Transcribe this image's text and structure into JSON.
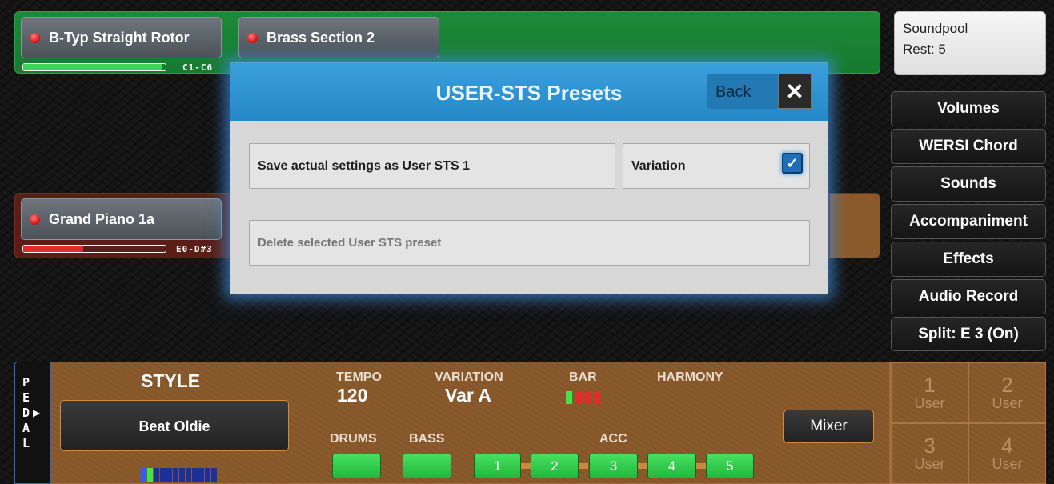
{
  "upper_manual": {
    "sounds": [
      {
        "name": "B-Typ Straight Rotor",
        "range": "C1-C6",
        "level": 0.98
      },
      {
        "name": "Brass Section 2"
      }
    ]
  },
  "lower_manual": {
    "sounds": [
      {
        "name": "Grand Piano 1a",
        "range": "E0-D#3",
        "level": 0.42
      }
    ]
  },
  "soundpool": {
    "line1": "Soundpool",
    "line2": "Rest: 5"
  },
  "side_menu": [
    "Volumes",
    "WERSI Chord",
    "Sounds",
    "Accompaniment",
    "Effects",
    "Audio Record",
    "Split: E 3 (On)"
  ],
  "dialog": {
    "title": "USER-STS Presets",
    "back": "Back",
    "close": "✕",
    "save_label": "Save actual settings as User STS 1",
    "variation_label": "Variation",
    "variation_checked": true,
    "delete_label": "Delete selected User STS preset"
  },
  "pedal": {
    "letters": [
      "P",
      "E",
      "D",
      "A",
      "L"
    ]
  },
  "style_panel": {
    "style_title": "STYLE",
    "style_name": "Beat Oldie",
    "tempo_label": "TEMPO",
    "tempo_value": "120",
    "variation_label": "VARIATION",
    "variation_value": "Var A",
    "bar_label": "BAR",
    "bar_current": 1,
    "bar_count": 4,
    "harmony_label": "HARMONY",
    "drums_label": "DRUMS",
    "bass_label": "BASS",
    "acc_label": "ACC",
    "acc_buttons": [
      "1",
      "2",
      "3",
      "4",
      "5"
    ],
    "mixer": "Mixer"
  },
  "user_presets": [
    {
      "num": "1",
      "label": "User"
    },
    {
      "num": "2",
      "label": "User"
    },
    {
      "num": "3",
      "label": "User"
    },
    {
      "num": "4",
      "label": "User"
    }
  ],
  "colors": {
    "upper_manual": "#1d8a39",
    "lower_manual": "#5a1e16",
    "dialog_header": "#2a8fd0",
    "style_panel": "#8a5a2c",
    "active_green": "#33cc4d",
    "led_red": "#e01818"
  }
}
